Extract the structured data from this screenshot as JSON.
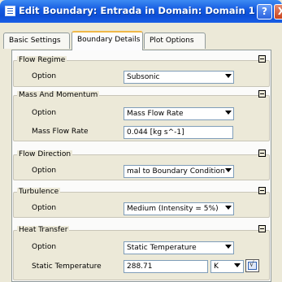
{
  "window": {
    "title": "Edit Boundary: Entrada in Domain: Domain 1",
    "help_label": "?",
    "close_label": "X"
  },
  "tabs": [
    "Basic Settings",
    "Boundary Details",
    "Plot Options"
  ],
  "active_tab": "Boundary Details",
  "sections": {
    "flow_regime": {
      "title": "Flow Regime",
      "option_label": "Option",
      "option_value": "Subsonic"
    },
    "mass_momentum": {
      "title": "Mass And Momentum",
      "option_label": "Option",
      "option_value": "Mass Flow Rate",
      "rate_label": "Mass Flow Rate",
      "rate_value": "0.044 [kg s^-1]"
    },
    "flow_direction": {
      "title": "Flow Direction",
      "option_label": "Option",
      "option_value": "mal to Boundary Condition"
    },
    "turbulence": {
      "title": "Turbulence",
      "option_label": "Option",
      "option_value": "Medium (Intensity = 5%)"
    },
    "heat_transfer": {
      "title": "Heat Transfer",
      "option_label": "Option",
      "option_value": "Static Temperature",
      "temp_label": "Static Temperature",
      "temp_value": "288.71",
      "temp_unit": "K"
    }
  }
}
